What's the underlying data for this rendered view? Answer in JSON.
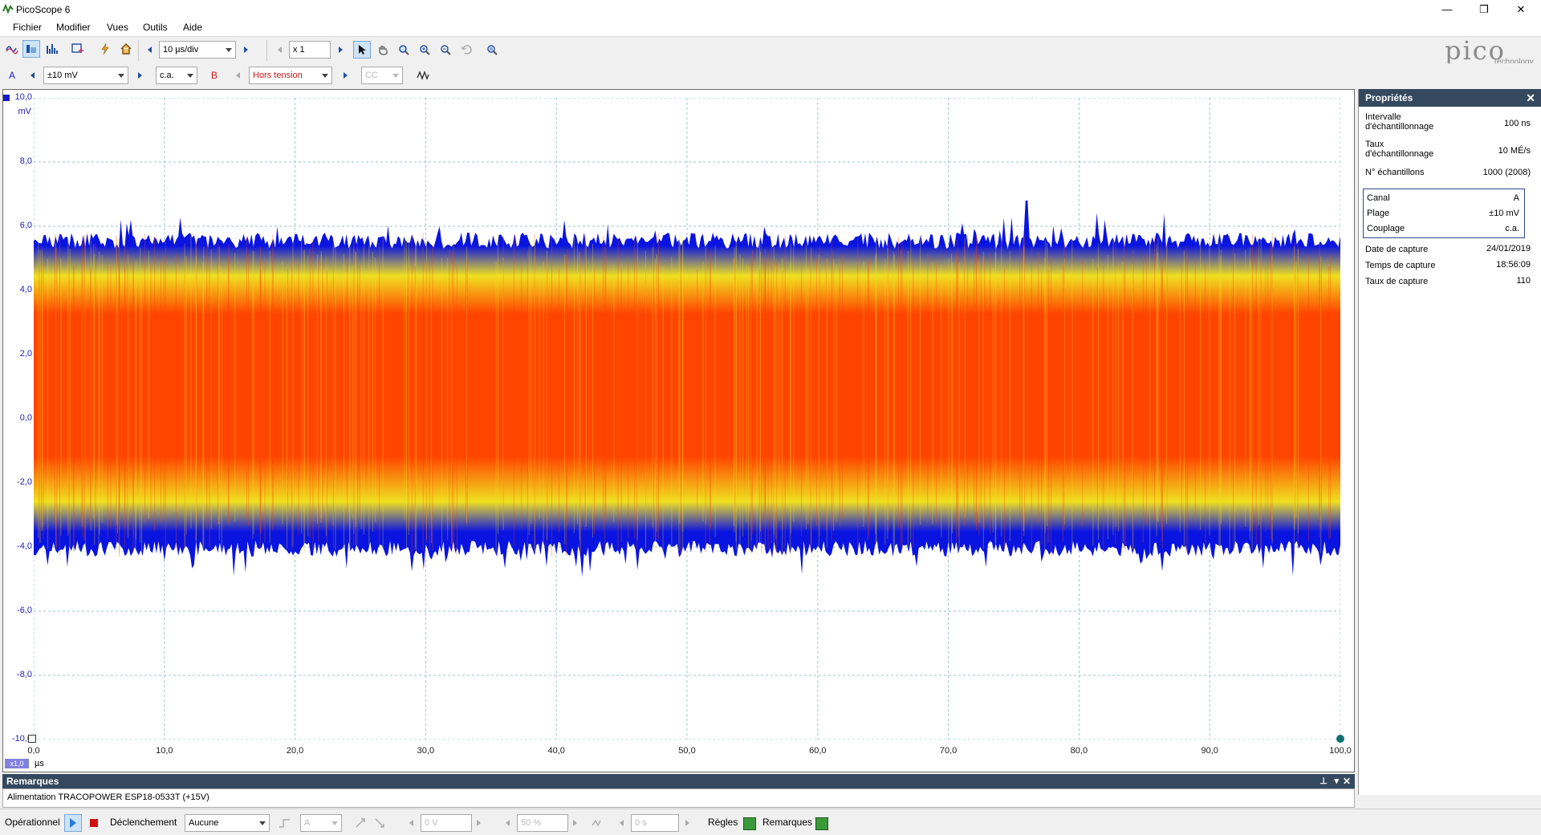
{
  "window": {
    "title": "PicoScope 6",
    "minimize": "—",
    "restore": "❐",
    "close": "✕"
  },
  "menu": [
    "Fichier",
    "Modifier",
    "Vues",
    "Outils",
    "Aide"
  ],
  "toolbar": {
    "timebase": "10 µs/div",
    "zoom": "x 1"
  },
  "channel_a": {
    "label": "A",
    "range": "±10 mV",
    "coupling": "c.a.",
    "color": "#1a1acc"
  },
  "channel_b": {
    "label": "B",
    "range": "Hors tension",
    "coupling": "CC",
    "color": "#cc1a1a"
  },
  "logo": {
    "name": "pico",
    "sub": "Technology"
  },
  "chart_data": {
    "type": "line",
    "title": "",
    "ylabel": "mV",
    "xlabel": "µs",
    "y_ticks": [
      "10,0",
      "8,0",
      "6,0",
      "4,0",
      "2,0",
      "0,0",
      "-2,0",
      "-4,0",
      "-6,0",
      "-8,0",
      "-10,0"
    ],
    "x_ticks": [
      "0,0",
      "10,0",
      "20,0",
      "30,0",
      "40,0",
      "50,0",
      "60,0",
      "70,0",
      "80,0",
      "90,0",
      "100,0"
    ],
    "xlim": [
      0,
      100
    ],
    "ylim": [
      -10,
      10
    ],
    "grid": true,
    "series": [
      {
        "values_envelope": {
          "upper": 5.8,
          "lower": -4.3,
          "peak_max": 6.8,
          "peak_min": -5.1
        },
        "spike_at_us": 76,
        "color_hot": "#ff4500",
        "color_mid": "#f0e020",
        "color_cold": "#0a14e0"
      }
    ]
  },
  "x_scale_badge": "x1,0",
  "x_unit": "µs",
  "properties": {
    "header": "Propriétés",
    "rows": [
      {
        "label": "Intervalle\nd'échantillonnage",
        "value": "100 ns"
      },
      {
        "label": "Taux\nd'échantillonnage",
        "value": "10 MÉ/s"
      },
      {
        "label": "N° échantillons",
        "value": "1000  (2008)"
      }
    ],
    "channel_rows": [
      {
        "label": "Canal",
        "value": "A"
      },
      {
        "label": "Plage",
        "value": "±10 mV"
      },
      {
        "label": "Couplage",
        "value": "c.a."
      }
    ],
    "capture_rows": [
      {
        "label": "Date de capture",
        "value": "24/01/2019"
      },
      {
        "label": "Temps de capture",
        "value": "18:56:09"
      },
      {
        "label": "Taux de capture",
        "value": "110"
      }
    ]
  },
  "remarks": {
    "header": "Remarques",
    "text": "Alimentation TRACOPOWER ESP18-0533T (+15V)"
  },
  "statusbar": {
    "mode": "Opérationnel",
    "trigger_label": "Déclenchement",
    "trigger_value": "Aucune",
    "trig_channel": "A",
    "threshold": "0 V",
    "pretrigger": "50 %",
    "delay": "0 s",
    "rules": "Règles",
    "notes": "Remarques"
  }
}
